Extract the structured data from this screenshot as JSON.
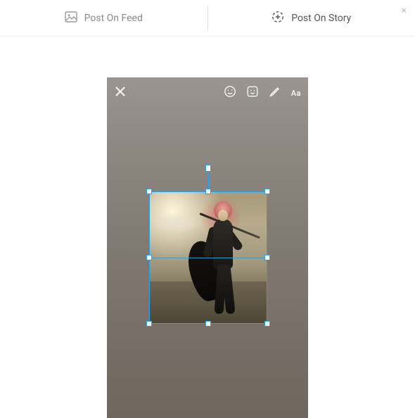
{
  "tabs": {
    "feed": {
      "label": "Post On Feed"
    },
    "story": {
      "label": "Post On Story"
    }
  },
  "dialog_close": {
    "glyph": "×"
  },
  "story_editor": {
    "text_tool_label": "Aa"
  }
}
